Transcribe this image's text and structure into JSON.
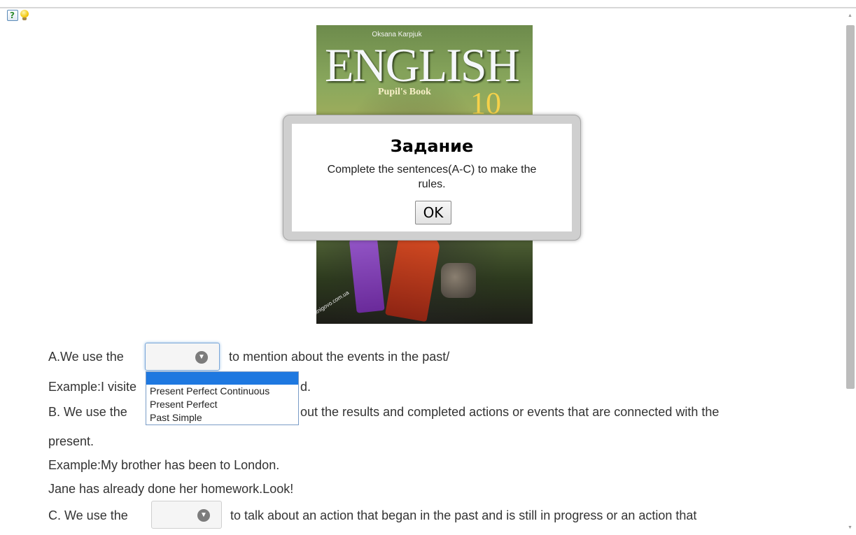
{
  "toolbar": {
    "help_icon": "help-question-icon",
    "hint_icon": "lightbulb-icon"
  },
  "cover": {
    "author": "Oksana Karpjuk",
    "title": "ENGLISH",
    "subtitle": "Pupil's Book",
    "grade": "10",
    "watermark": "knigovo.com.ua"
  },
  "dialog": {
    "title": "Задание",
    "message": "Complete the sentences(A-C) to make the rules.",
    "ok_label": "OK"
  },
  "content": {
    "a_prefix": "A.We use the",
    "a_suffix": "to mention about the events in the past/",
    "example_a_start": "Example:I visite",
    "example_a_end": "d.",
    "b_prefix": "B. We use the",
    "b_suffix": "out the results and completed actions or events that are connected with the",
    "b_cont": "present.",
    "example_b": "Example:My brother has been to London.",
    "example_b2": "Jane has already done her homework.Look!",
    "c_prefix": "C. We use the",
    "c_suffix": "to talk about an action that began in the past and is still in progress or an action that"
  },
  "dropdown": {
    "selected": "",
    "options": [
      "",
      "Present Perfect Continuous",
      "Present Perfect",
      "Past Simple"
    ]
  },
  "colors": {
    "accent": "#1e78e0",
    "focus_border": "#7aa7d8"
  }
}
